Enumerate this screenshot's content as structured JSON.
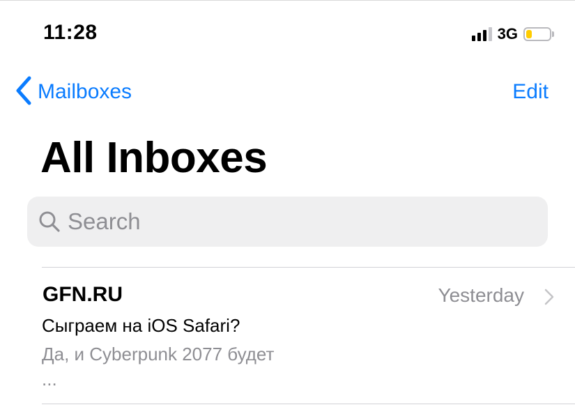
{
  "status_bar": {
    "time": "11:28",
    "network": "3G",
    "signal_bars_active": 3,
    "signal_bars_total": 4,
    "battery_color": "#ffcc00",
    "battery_level": 0.25
  },
  "nav": {
    "back_label": "Mailboxes",
    "back_icon": "chevron-left-icon",
    "edit_label": "Edit",
    "accent_color": "#0a7cff"
  },
  "title": "All Inboxes",
  "search": {
    "placeholder": "Search",
    "icon": "search-icon"
  },
  "messages": [
    {
      "sender": "GFN.RU",
      "date": "Yesterday",
      "subject": "Сыграем на iOS Safari?",
      "preview_line1": "Да, и Cyberpunk 2077 будет",
      "preview_line2": "..."
    }
  ]
}
